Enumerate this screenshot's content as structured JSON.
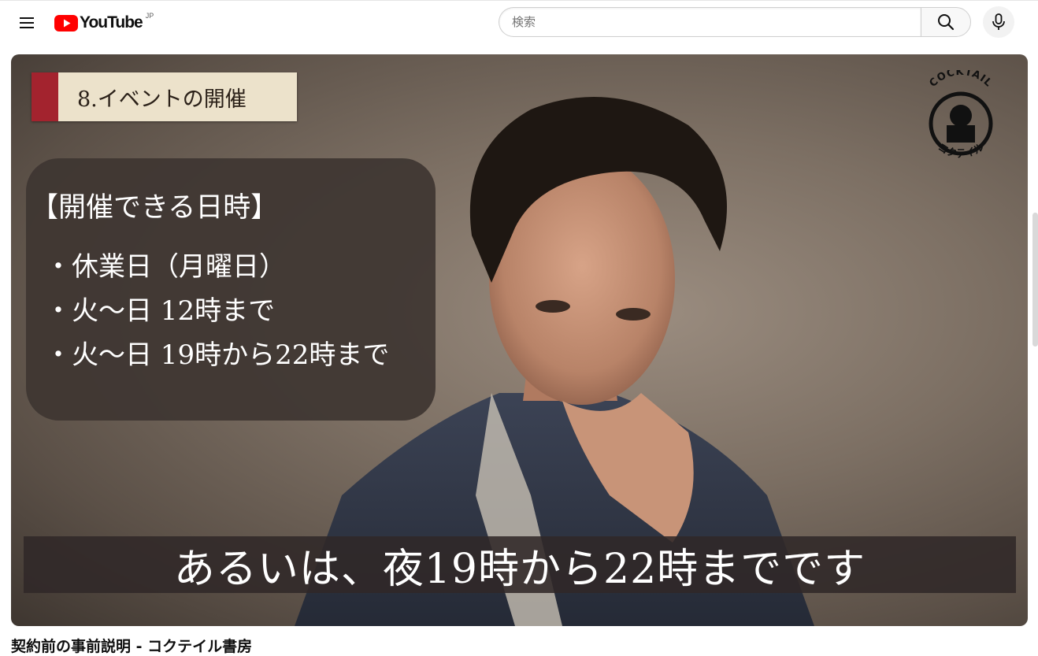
{
  "header": {
    "logo_text": "YouTube",
    "region_code": "JP",
    "search_placeholder": "検索"
  },
  "video": {
    "chapter_label": "8.イベントの開催",
    "panel_heading": "【開催できる日時】",
    "panel_items": [
      "・休業日（月曜日）",
      "・火～日 12時まで",
      "・火～日 19時から22時まで"
    ],
    "channel_logo_top": "COCKTAIL",
    "channel_logo_bottom": "コクテイル",
    "subtitle": "あるいは、夜19時から22時までです"
  },
  "title": "契約前の事前説明 - コクテイル書房",
  "colors": {
    "brand_red": "#ff0000",
    "chapter_bar": "#a3232e",
    "chapter_bg": "#ece2cb"
  }
}
